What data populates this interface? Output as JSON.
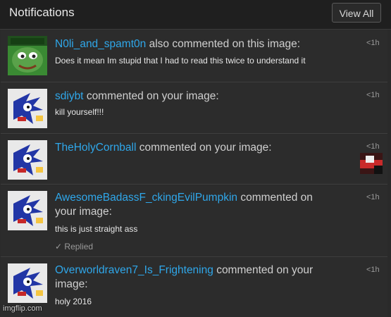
{
  "header": {
    "title": "Notifications",
    "view_all_label": "View All"
  },
  "notifications": [
    {
      "username": "N0li_and_spamt0n",
      "action": "also commented on this image:",
      "comment": "Does it mean Im stupid that I had to read this twice to understand it",
      "time": "<1h",
      "avatar": "pepe-avatar"
    },
    {
      "username": "sdiybt",
      "action": "commented on your image:",
      "comment": "kill yourself!!!",
      "time": "<1h",
      "avatar": "sonic-avatar"
    },
    {
      "username": "TheHolyCornball",
      "action": "commented on your image:",
      "comment": "",
      "time": "<1h",
      "avatar": "sonic-avatar",
      "preview": "image-preview"
    },
    {
      "username": "AwesomeBadassF_ckingEvilPumpkin",
      "action": "commented on your image:",
      "comment": "this is just straight ass",
      "time": "<1h",
      "avatar": "sonic-avatar",
      "replied": "Replied"
    },
    {
      "username": "Overworldraven7_Is_Frightening",
      "action": "commented on your image:",
      "comment": "holy 2016",
      "time": "<1h",
      "avatar": "sonic-avatar"
    }
  ],
  "watermark": "imgflip.com",
  "colors": {
    "username": "#2fa7ea",
    "background": "#2b2b2b",
    "header": "#1f1f1f",
    "text": "#cfcfcf"
  }
}
